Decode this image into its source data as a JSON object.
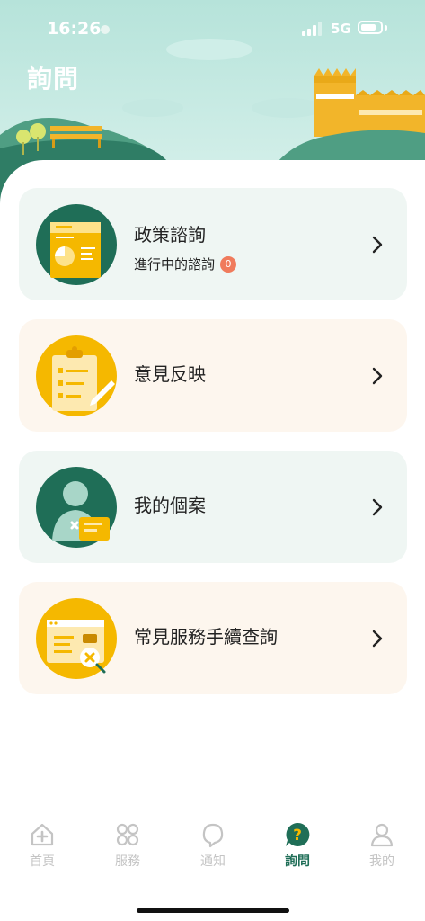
{
  "status_bar": {
    "time": "16:26",
    "network": "5G"
  },
  "page": {
    "title": "詢問"
  },
  "cards": [
    {
      "title": "政策諮詢",
      "subtitle": "進行中的諮詢",
      "badge": "0",
      "icon": "policy-chart-icon"
    },
    {
      "title": "意見反映",
      "icon": "clipboard-feedback-icon"
    },
    {
      "title": "我的個案",
      "icon": "person-case-icon"
    },
    {
      "title": "常見服務手續查詢",
      "icon": "service-window-icon"
    }
  ],
  "tabs": [
    {
      "label": "首頁",
      "icon": "home-icon",
      "active": false
    },
    {
      "label": "服務",
      "icon": "services-grid-icon",
      "active": false
    },
    {
      "label": "通知",
      "icon": "notification-icon",
      "active": false
    },
    {
      "label": "詢問",
      "icon": "question-bubble-icon",
      "active": true
    },
    {
      "label": "我的",
      "icon": "profile-icon",
      "active": false
    }
  ],
  "colors": {
    "accent": "#1f6e57",
    "yellow": "#f5b800",
    "header_bg": "#c9ebe4",
    "card_green": "#eff6f3",
    "card_cream": "#fdf6ee",
    "badge": "#f07b5c"
  }
}
